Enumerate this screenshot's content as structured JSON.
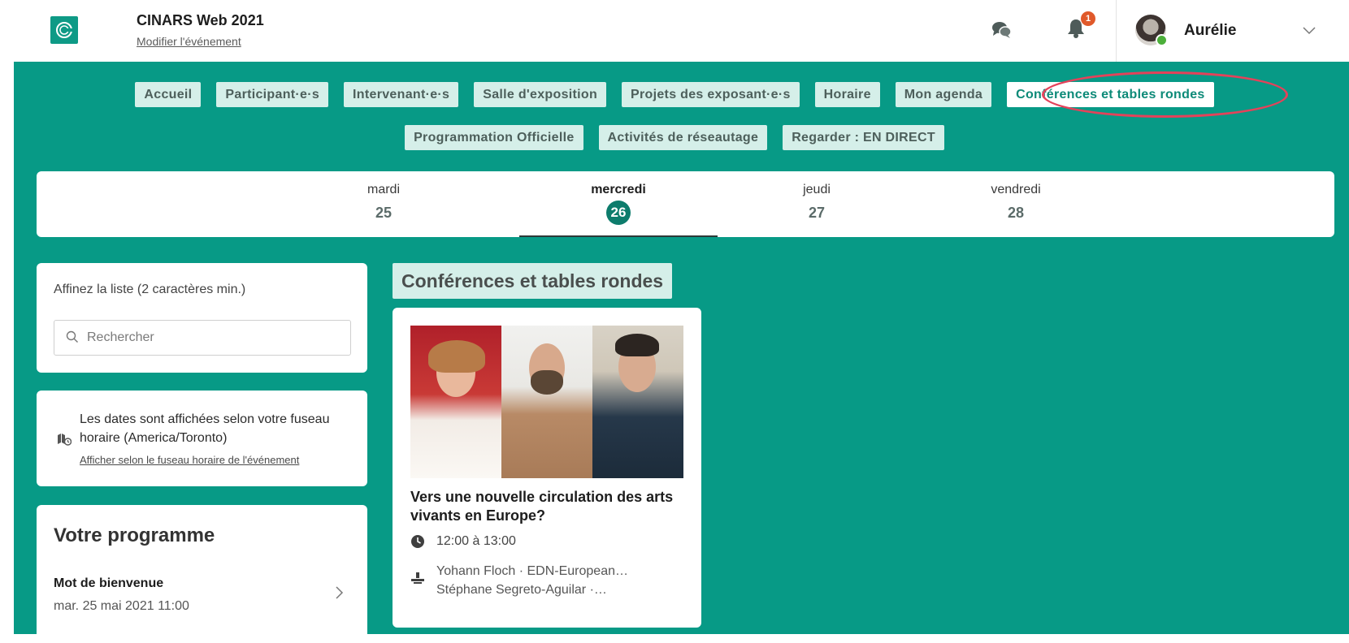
{
  "header": {
    "event_title": "CINARS Web 2021",
    "edit_link": "Modifier l'événement",
    "notifications_count": "1",
    "user_name": "Aurélie",
    "colors": {
      "brand": "#079a86",
      "badge": "#e0592a",
      "online": "#4caf3a"
    },
    "icons": [
      "logo-icon",
      "chat-icon",
      "bell-icon",
      "chevron-down-icon"
    ]
  },
  "nav": {
    "row1": [
      {
        "label": "Accueil"
      },
      {
        "label": "Participant·e·s"
      },
      {
        "label": "Intervenant·e·s"
      },
      {
        "label": "Salle d'exposition"
      },
      {
        "label": "Projets des exposant·e·s"
      },
      {
        "label": "Horaire"
      },
      {
        "label": "Mon agenda"
      },
      {
        "label": "Conférences et tables rondes",
        "active": true
      }
    ],
    "row2": [
      {
        "label": "Programmation Officielle"
      },
      {
        "label": "Activités de réseautage"
      },
      {
        "label": "Regarder : EN DIRECT"
      }
    ]
  },
  "days": [
    {
      "name": "mardi",
      "num": "25"
    },
    {
      "name": "mercredi",
      "num": "26",
      "selected": true
    },
    {
      "name": "jeudi",
      "num": "27"
    },
    {
      "name": "vendredi",
      "num": "28"
    }
  ],
  "filter": {
    "label": "Affinez la liste (2 caractères min.)",
    "placeholder": "Rechercher",
    "value": ""
  },
  "timezone": {
    "text": "Les dates sont affichées selon votre fuseau horaire (America/Toronto)",
    "link": "Afficher selon le fuseau horaire de l'événement"
  },
  "programme": {
    "title": "Votre programme",
    "items": [
      {
        "title": "Mot de bienvenue",
        "date": "mar. 25 mai 2021 11:00"
      }
    ]
  },
  "section": {
    "title": "Conférences et tables rondes",
    "sessions": [
      {
        "title": "Vers une nouvelle circulation des arts vivants en Europe?",
        "time": "12:00 à 13:00",
        "speakers": [
          "Yohann Floch · EDN-European…",
          "Stéphane Segreto-Aguilar ·…"
        ]
      }
    ]
  }
}
